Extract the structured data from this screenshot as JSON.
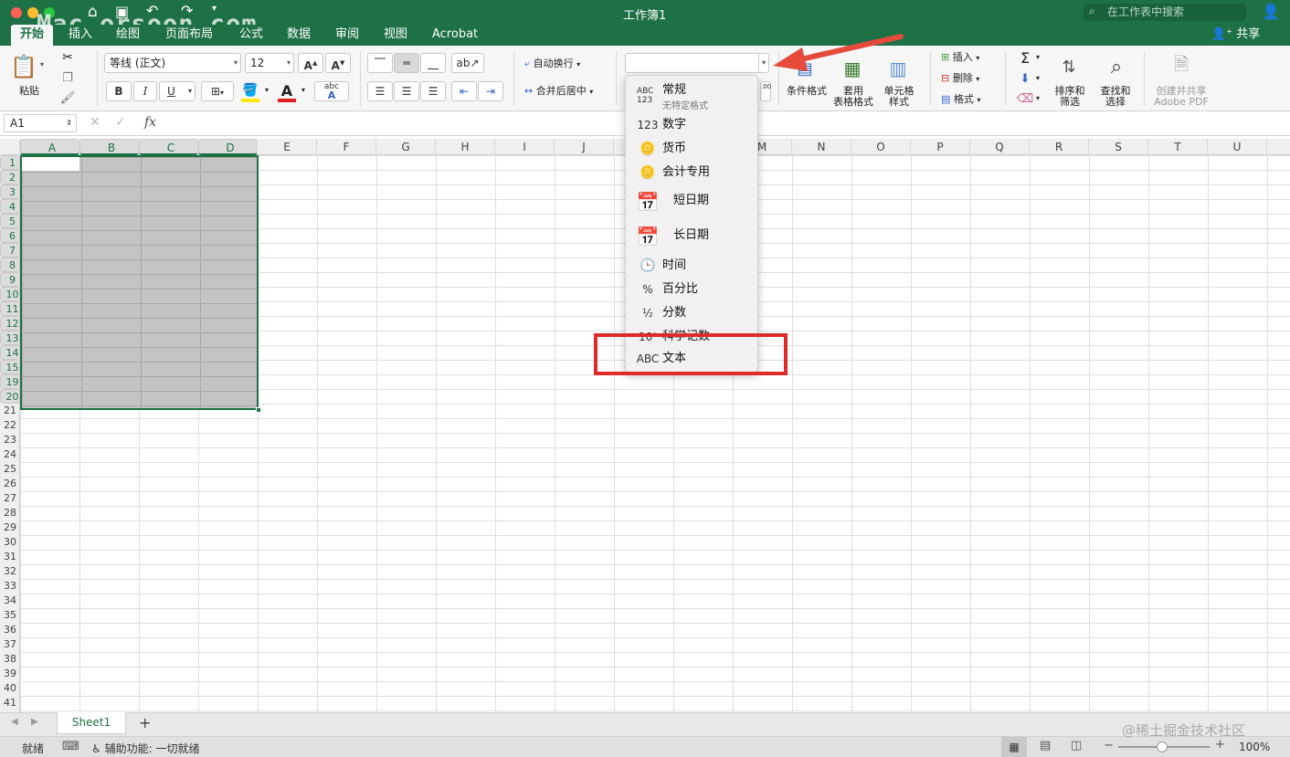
{
  "window": {
    "title": "工作簿1",
    "search_placeholder": "在工作表中搜索",
    "share": "共享",
    "watermark": "Mac.orsoon.com"
  },
  "tabs": [
    "开始",
    "插入",
    "绘图",
    "页面布局",
    "公式",
    "数据",
    "审阅",
    "视图",
    "Acrobat"
  ],
  "ribbon": {
    "paste": "粘贴",
    "font_name": "等线 (正文)",
    "font_size": "12",
    "bold": "B",
    "italic": "I",
    "underline": "U",
    "wrap_text": "自动换行",
    "merge_center": "合并后居中",
    "number_format": "",
    "conditional_format": "条件格式",
    "table_format_1": "套用",
    "table_format_2": "表格格式",
    "cell_style_1": "单元格",
    "cell_style_2": "样式",
    "insert": "插入",
    "delete": "删除",
    "format": "格式",
    "sort_filter_1": "排序和",
    "sort_filter_2": "筛选",
    "find_select_1": "查找和",
    "find_select_2": "选择",
    "pdf_1": "创建并共享",
    "pdf_2": "Adobe PDF"
  },
  "formula_bar": {
    "name_box": "A1",
    "fx": "fx",
    "value": ""
  },
  "grid": {
    "columns": [
      "A",
      "B",
      "C",
      "D",
      "E",
      "F",
      "G",
      "H",
      "I",
      "J",
      "K",
      "L",
      "M",
      "N",
      "O",
      "P",
      "Q",
      "R",
      "S",
      "T",
      "U"
    ],
    "rows": [
      "1",
      "2",
      "3",
      "4",
      "5",
      "6",
      "7",
      "8",
      "9",
      "10",
      "11",
      "12",
      "13",
      "14",
      "15",
      "19",
      "20",
      "21",
      "22",
      "23",
      "24",
      "25",
      "26",
      "27",
      "28",
      "29",
      "30",
      "31",
      "32",
      "33",
      "34",
      "35",
      "36",
      "37",
      "38",
      "39",
      "40",
      "41"
    ]
  },
  "number_format_menu": [
    {
      "icon": "ABC 123",
      "label": "常规",
      "sub": "无特定格式"
    },
    {
      "icon": "123",
      "label": "数字"
    },
    {
      "icon": "coins-icon",
      "label": "货币"
    },
    {
      "icon": "accounting-icon",
      "label": "会计专用"
    },
    {
      "icon": "calendar-clock-icon",
      "label": "短日期"
    },
    {
      "icon": "calendar-clock-icon",
      "label": "长日期"
    },
    {
      "icon": "clock-icon",
      "label": "时间"
    },
    {
      "icon": "%",
      "label": "百分比"
    },
    {
      "icon": "½",
      "label": "分数"
    },
    {
      "icon": "10²",
      "label": "科学记数"
    },
    {
      "icon": "ABC",
      "label": "文本"
    }
  ],
  "sheets": {
    "active": "Sheet1",
    "add": "+"
  },
  "status": {
    "ready": "就绪",
    "accessibility": "辅助功能: 一切就绪",
    "zoom": "100%",
    "corner_watermark": "@稀土掘金技术社区"
  },
  "colors": {
    "excel_green": "#1e7145",
    "highlight_red": "#e02a2a",
    "selection_gray": "#c4c4c4"
  }
}
